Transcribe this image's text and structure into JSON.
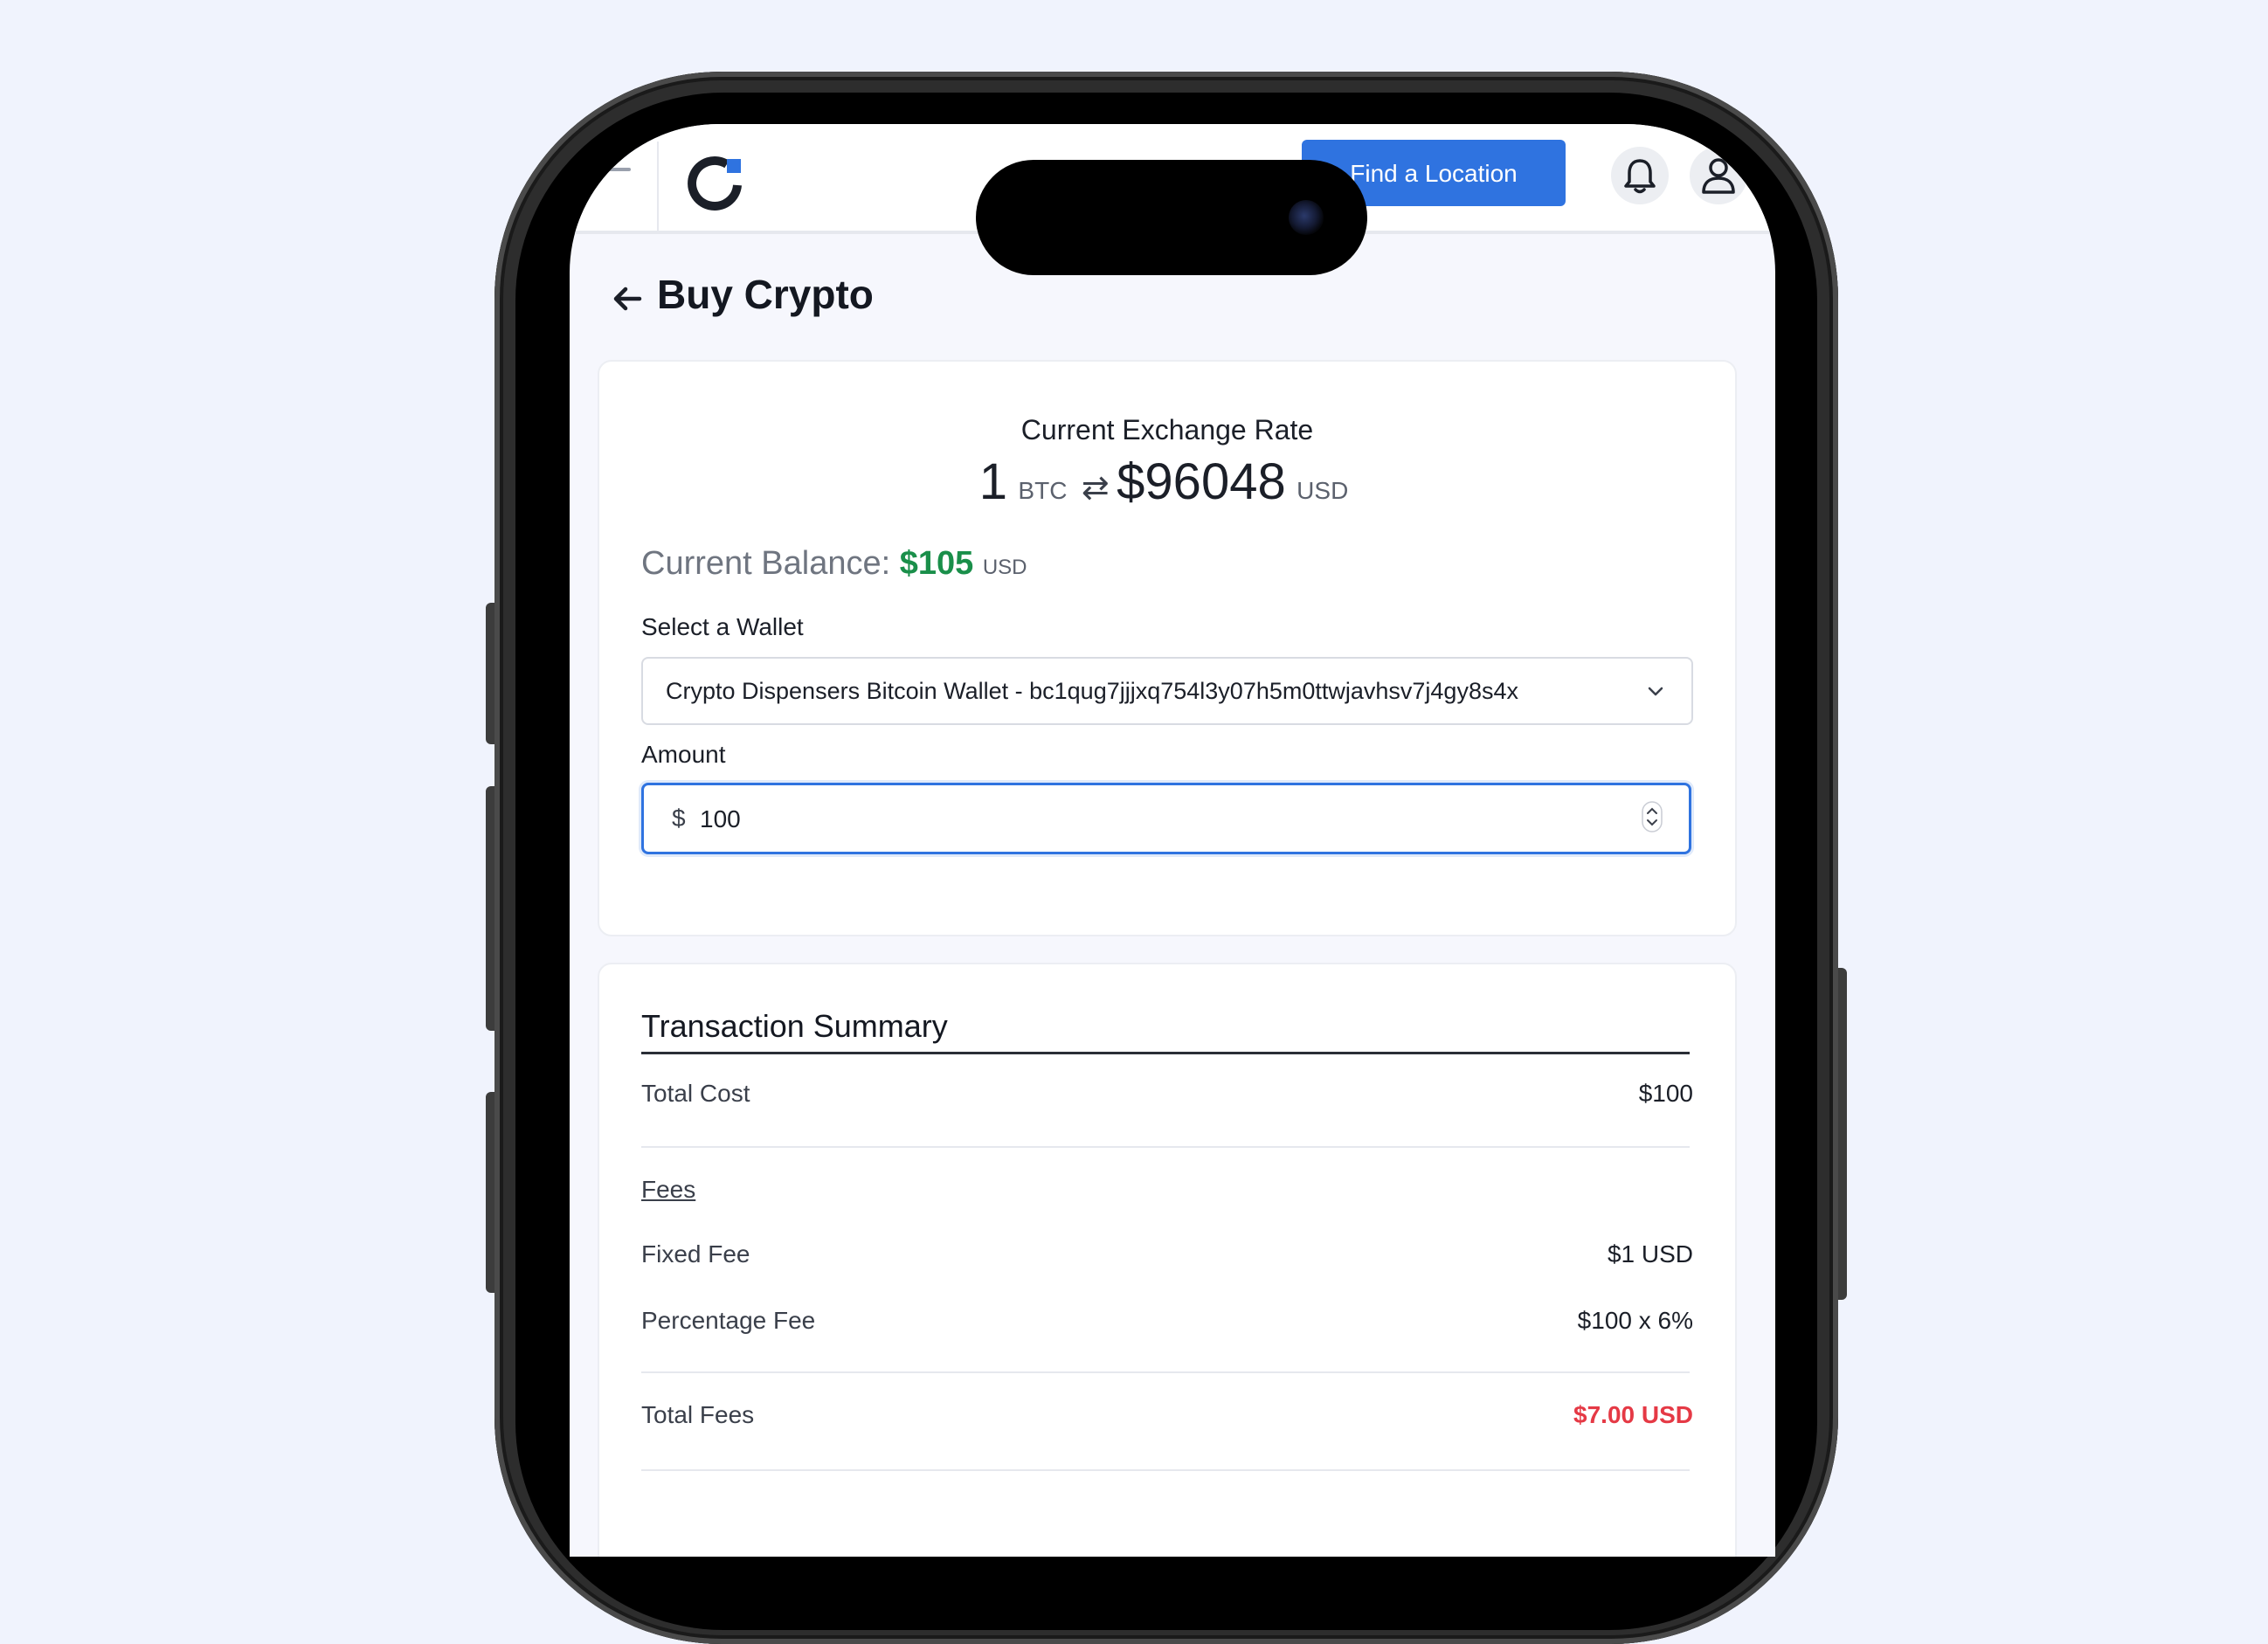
{
  "header": {
    "find_button": "Find a Location"
  },
  "page": {
    "title": "Buy Crypto"
  },
  "exchange": {
    "label": "Current Exchange Rate",
    "amount": "1",
    "from_unit": "BTC",
    "rate": "$96048",
    "to_unit": "USD"
  },
  "balance": {
    "label": "Current Balance:",
    "value": "$105",
    "unit": "USD"
  },
  "wallet": {
    "label": "Select a Wallet",
    "selected": "Crypto Dispensers Bitcoin Wallet - bc1qug7jjjxq754l3y07h5m0ttwjavhsv7j4gy8s4x"
  },
  "amount": {
    "label": "Amount",
    "prefix": "$",
    "value": "100"
  },
  "summary": {
    "title": "Transaction Summary",
    "total_cost_label": "Total Cost",
    "total_cost_value": "$100",
    "fees_heading": "Fees",
    "fixed_fee_label": "Fixed Fee",
    "fixed_fee_value": "$1 USD",
    "percentage_fee_label": "Percentage Fee",
    "percentage_fee_value": "$100 x 6%",
    "total_fees_label": "Total Fees",
    "total_fees_value": "$7.00 USD"
  },
  "colors": {
    "accent": "#2f73e0",
    "balance_green": "#1a8f4a",
    "fees_red": "#e53945"
  }
}
